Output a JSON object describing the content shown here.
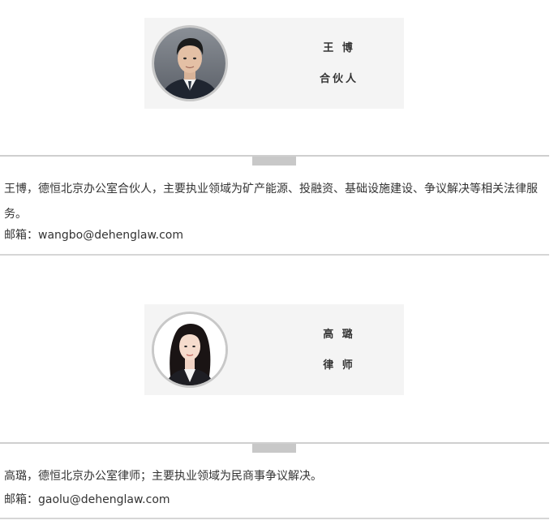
{
  "profiles": [
    {
      "name": "王 博",
      "title": "合伙人",
      "bio": "王博，德恒北京办公室合伙人，主要执业领域为矿产能源、投融资、基础设施建设、争议解决等相关法律服务。",
      "email": "邮箱：wangbo@dehenglaw.com"
    },
    {
      "name": "高 璐",
      "title": "律 师",
      "bio": "高璐，德恒北京办公室律师；主要执业领域为民商事争议解决。",
      "email": "邮箱：gaolu@dehenglaw.com"
    }
  ]
}
